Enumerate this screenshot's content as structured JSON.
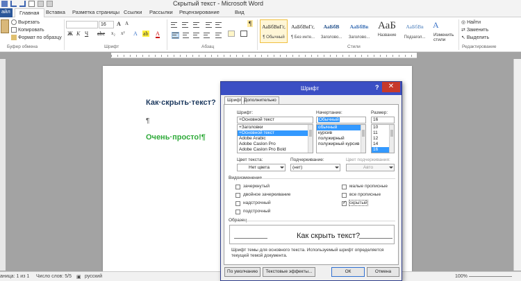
{
  "app": {
    "window_title": "Скрытый текст - Microsoft Word"
  },
  "ribbon_tabs": [
    {
      "label": "Главная",
      "active": true
    },
    {
      "label": "Вставка"
    },
    {
      "label": "Разметка страницы"
    },
    {
      "label": "Ссылки"
    },
    {
      "label": "Рассылки"
    },
    {
      "label": "Рецензирование"
    },
    {
      "label": "Вид"
    }
  ],
  "file_tab_label": "айл",
  "clipboard": {
    "cut": "Вырезать",
    "copy": "Копировать",
    "format_painter": "Формат по образцу",
    "group_label": "Буфер обмена"
  },
  "font_group": {
    "size": "16",
    "label": "Шрифт"
  },
  "paragraph_group": {
    "label": "Абзац"
  },
  "styles": {
    "label": "Стили",
    "tiles": [
      {
        "preview": "АаБбВвГг,",
        "name": "¶ Обычный",
        "selected": true
      },
      {
        "preview": "АаБбВвГг,",
        "name": "¶ Без инте..."
      },
      {
        "preview": "АаБбВ",
        "name": "Заголово..."
      },
      {
        "preview": "АаБбВв",
        "name": "Заголово..."
      },
      {
        "preview": "АаБ",
        "name": "Название",
        "big": true
      },
      {
        "preview": "АаБбВв",
        "name": "Подзагол..."
      }
    ],
    "change_styles": "Изменить стили"
  },
  "editing": {
    "find": "Найти",
    "replace": "Заменить",
    "select": "Выделить",
    "label": "Редактирование"
  },
  "document": {
    "line1": "Как·скрыть·текст?",
    "line2": "¶",
    "line3": "Очень·просто!¶"
  },
  "status_bar": {
    "page": "аница: 1 из 1",
    "words": "Число слов: 5/5",
    "language": "русский",
    "zoom": "100%"
  },
  "font_dialog": {
    "title": "Шрифт",
    "help": "?",
    "close": "✕",
    "tabs": [
      "Шрифт",
      "Дополнительно"
    ],
    "font_label": "Шрифт:",
    "font_value": "+Основной текст",
    "font_list": [
      "+Заголовки",
      "+Основной текст",
      "Adobe Arabic",
      "Adobe Caslon Pro",
      "Adobe Caslon Pro Bold"
    ],
    "font_selected_index": 1,
    "style_label": "Начертание:",
    "style_value": "Обычный",
    "style_list": [
      "обычный",
      "курсив",
      "полужирный",
      "полужирный курсив"
    ],
    "style_selected_index": 0,
    "size_label": "Размер:",
    "size_value": "16",
    "size_list": [
      "10",
      "11",
      "12",
      "14",
      "16"
    ],
    "size_selected_index": 4,
    "text_color_label": "Цвет текста:",
    "text_color_value": "Нет цвета",
    "underline_label": "Подчеркивание:",
    "underline_value": "(нет)",
    "underline_color_label": "Цвет подчеркивания:",
    "underline_color_value": "Авто",
    "effects_label": "Видоизменение",
    "effects_left": [
      {
        "label": "зачеркнутый",
        "checked": false
      },
      {
        "label": "двойное зачеркивание",
        "checked": false
      },
      {
        "label": "надстрочный",
        "checked": false
      },
      {
        "label": "подстрочный",
        "checked": false
      }
    ],
    "effects_right": [
      {
        "label": "малые прописные",
        "checked": false
      },
      {
        "label": "все прописные",
        "checked": false
      },
      {
        "label": "скрытый",
        "checked": true
      }
    ],
    "preview_label": "Образец",
    "preview_text": "Как скрыть текст?",
    "note": "Шрифт темы для основного текста. Используемый шрифт определяется текущей темой документа.",
    "btn_default": "По умолчанию",
    "btn_effects": "Текстовые эффекты...",
    "btn_ok": "ОК",
    "btn_cancel": "Отмена"
  }
}
